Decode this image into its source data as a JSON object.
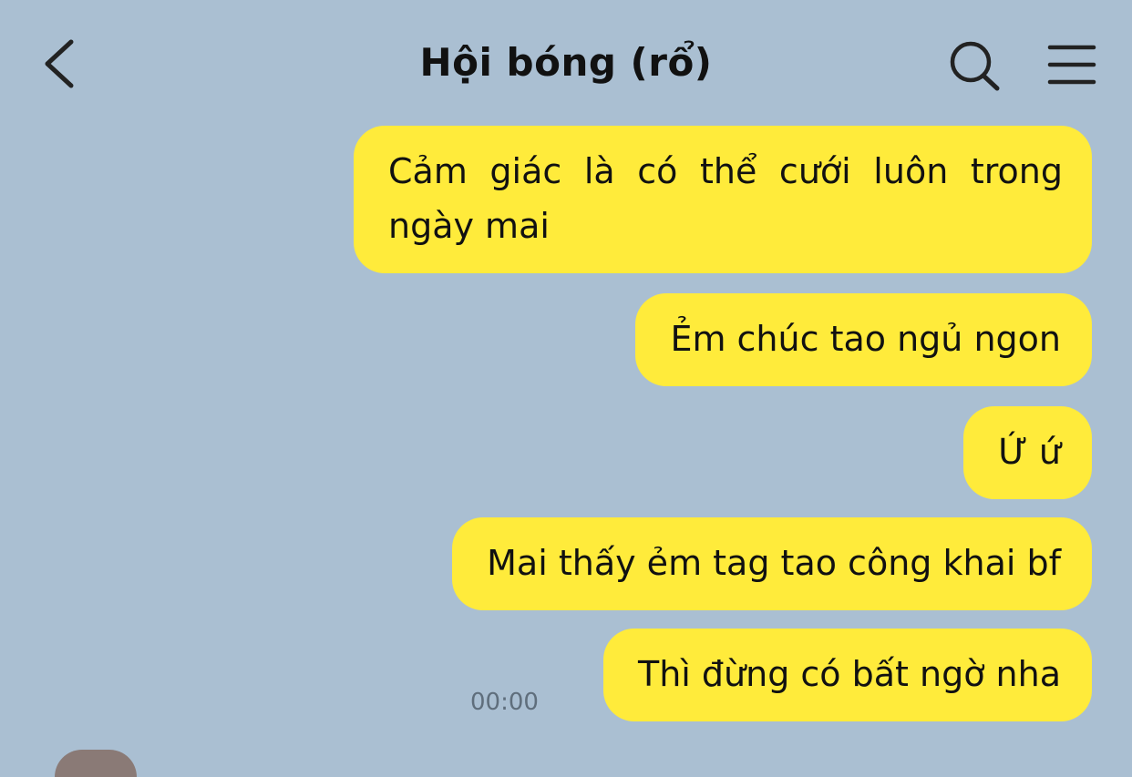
{
  "header": {
    "title": "Hội bóng (rổ)",
    "back_icon": "chevron-left-icon",
    "search_icon": "search-icon",
    "menu_icon": "hamburger-menu-icon"
  },
  "colors": {
    "background": "#aabfd2",
    "bubble": "#ffeb3b",
    "text": "#111111",
    "timestamp": "#5f6e7c"
  },
  "messages": [
    {
      "text": "Cảm giác là có thể cưới luôn trong ngày mai",
      "sender": "me"
    },
    {
      "text": "Ẻm chúc tao ngủ ngon",
      "sender": "me"
    },
    {
      "text": "Ứ ứ",
      "sender": "me"
    },
    {
      "text": "Mai thấy ẻm tag tao công khai bf",
      "sender": "me"
    },
    {
      "text": "Thì đừng có bất ngờ nha",
      "sender": "me"
    }
  ],
  "last_message_time": "00:00"
}
